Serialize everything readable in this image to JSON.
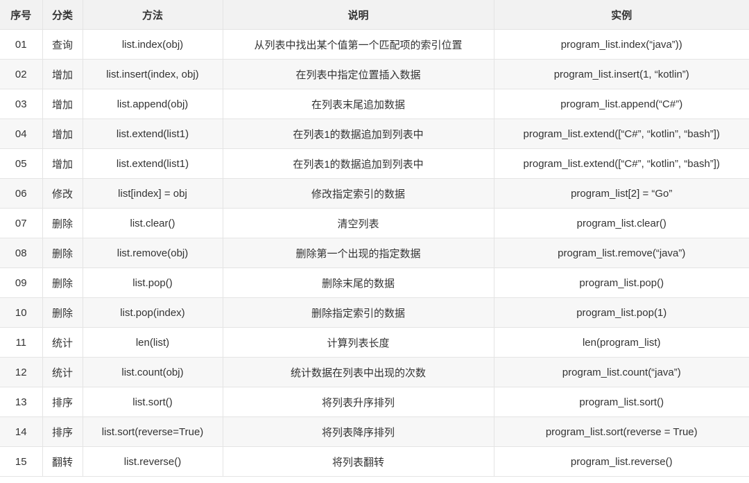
{
  "table": {
    "headers": [
      "序号",
      "分类",
      "方法",
      "说明",
      "实例"
    ],
    "rows": [
      {
        "no": "01",
        "category": "查询",
        "method": "list.index(obj)",
        "description": "从列表中找出某个值第一个匹配项的索引位置",
        "example": "program_list.index(“java”))"
      },
      {
        "no": "02",
        "category": "增加",
        "method": "list.insert(index, obj)",
        "description": "在列表中指定位置插入数据",
        "example": "program_list.insert(1, “kotlin”)"
      },
      {
        "no": "03",
        "category": "增加",
        "method": "list.append(obj)",
        "description": "在列表末尾追加数据",
        "example": "program_list.append(“C#”)"
      },
      {
        "no": "04",
        "category": "增加",
        "method": "list.extend(list1)",
        "description": "在列表1的数据追加到列表中",
        "example": "program_list.extend([“C#”, “kotlin”, “bash”])"
      },
      {
        "no": "05",
        "category": "增加",
        "method": "list.extend(list1)",
        "description": "在列表1的数据追加到列表中",
        "example": "program_list.extend([“C#”, “kotlin”, “bash”])"
      },
      {
        "no": "06",
        "category": "修改",
        "method": "list[index] = obj",
        "description": "修改指定索引的数据",
        "example": "program_list[2] = “Go”"
      },
      {
        "no": "07",
        "category": "删除",
        "method": "list.clear()",
        "description": "清空列表",
        "example": "program_list.clear()"
      },
      {
        "no": "08",
        "category": "删除",
        "method": "list.remove(obj)",
        "description": "删除第一个出现的指定数据",
        "example": "program_list.remove(“java”)"
      },
      {
        "no": "09",
        "category": "删除",
        "method": "list.pop()",
        "description": "删除末尾的数据",
        "example": "program_list.pop()"
      },
      {
        "no": "10",
        "category": "删除",
        "method": "list.pop(index)",
        "description": "删除指定索引的数据",
        "example": "program_list.pop(1)"
      },
      {
        "no": "11",
        "category": "统计",
        "method": "len(list)",
        "description": "计算列表长度",
        "example": "len(program_list)"
      },
      {
        "no": "12",
        "category": "统计",
        "method": "list.count(obj)",
        "description": "统计数据在列表中出现的次数",
        "example": "program_list.count(“java”)"
      },
      {
        "no": "13",
        "category": "排序",
        "method": "list.sort()",
        "description": "将列表升序排列",
        "example": "program_list.sort()"
      },
      {
        "no": "14",
        "category": "排序",
        "method": "list.sort(reverse=True)",
        "description": "将列表降序排列",
        "example": "program_list.sort(reverse = True)"
      },
      {
        "no": "15",
        "category": "翻转",
        "method": "list.reverse()",
        "description": "将列表翻转",
        "example": "program_list.reverse()"
      }
    ]
  }
}
